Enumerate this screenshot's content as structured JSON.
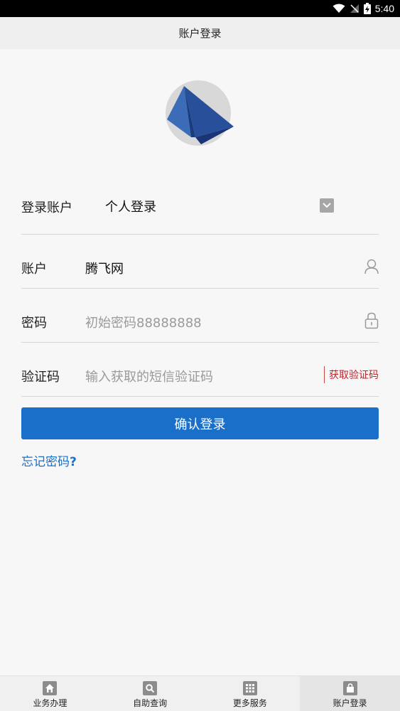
{
  "status_bar": {
    "time": "5:40"
  },
  "header": {
    "title": "账户登录"
  },
  "form": {
    "account_type": {
      "label": "登录账户",
      "value": "个人登录"
    },
    "account": {
      "label": "账户",
      "value": "腾飞网",
      "icon": "user-icon"
    },
    "password": {
      "label": "密码",
      "placeholder": "初始密码88888888",
      "icon": "lock-icon"
    },
    "verification": {
      "label": "验证码",
      "placeholder": "输入获取的短信验证码",
      "button_label": "获取验证码"
    },
    "submit_label": "确认登录",
    "forgot_label": "忘记密码",
    "forgot_mark": "?"
  },
  "tabs": [
    {
      "label": "业务办理",
      "icon": "home-icon"
    },
    {
      "label": "自助查询",
      "icon": "search-icon"
    },
    {
      "label": "更多服务",
      "icon": "grid-icon"
    },
    {
      "label": "账户登录",
      "icon": "bag-icon",
      "active": true
    }
  ],
  "colors": {
    "primary": "#1a6fc9",
    "sms_red": "#c0242a",
    "background": "#f7f7f7"
  }
}
